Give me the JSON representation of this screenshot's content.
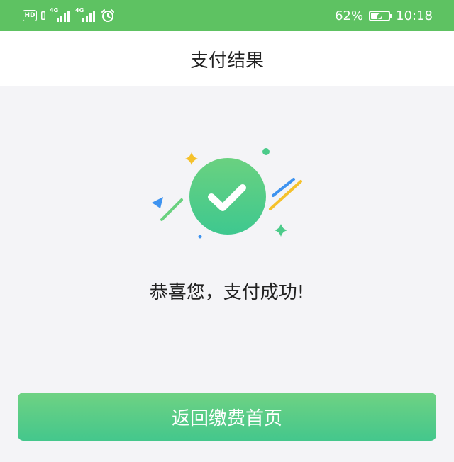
{
  "status_bar": {
    "hd_label": "HD",
    "network_1": "4G",
    "network_2": "4G",
    "battery_percent": "62%",
    "battery_level": 0.62,
    "time": "10:18"
  },
  "header": {
    "title": "支付结果"
  },
  "result": {
    "message": "恭喜您，支付成功!"
  },
  "actions": {
    "home_button_label": "返回缴费首页"
  },
  "colors": {
    "status_bar": "#5ec262",
    "accent_green": "#4ccb8a",
    "button_top": "#6fd283",
    "button_bottom": "#44c78c",
    "deco_yellow": "#f5c12b",
    "deco_blue": "#3e93f0",
    "deco_green": "#4ccb8a"
  },
  "icons": {
    "success": "check-circle-icon",
    "alarm": "alarm-clock-icon",
    "battery": "battery-icon"
  }
}
